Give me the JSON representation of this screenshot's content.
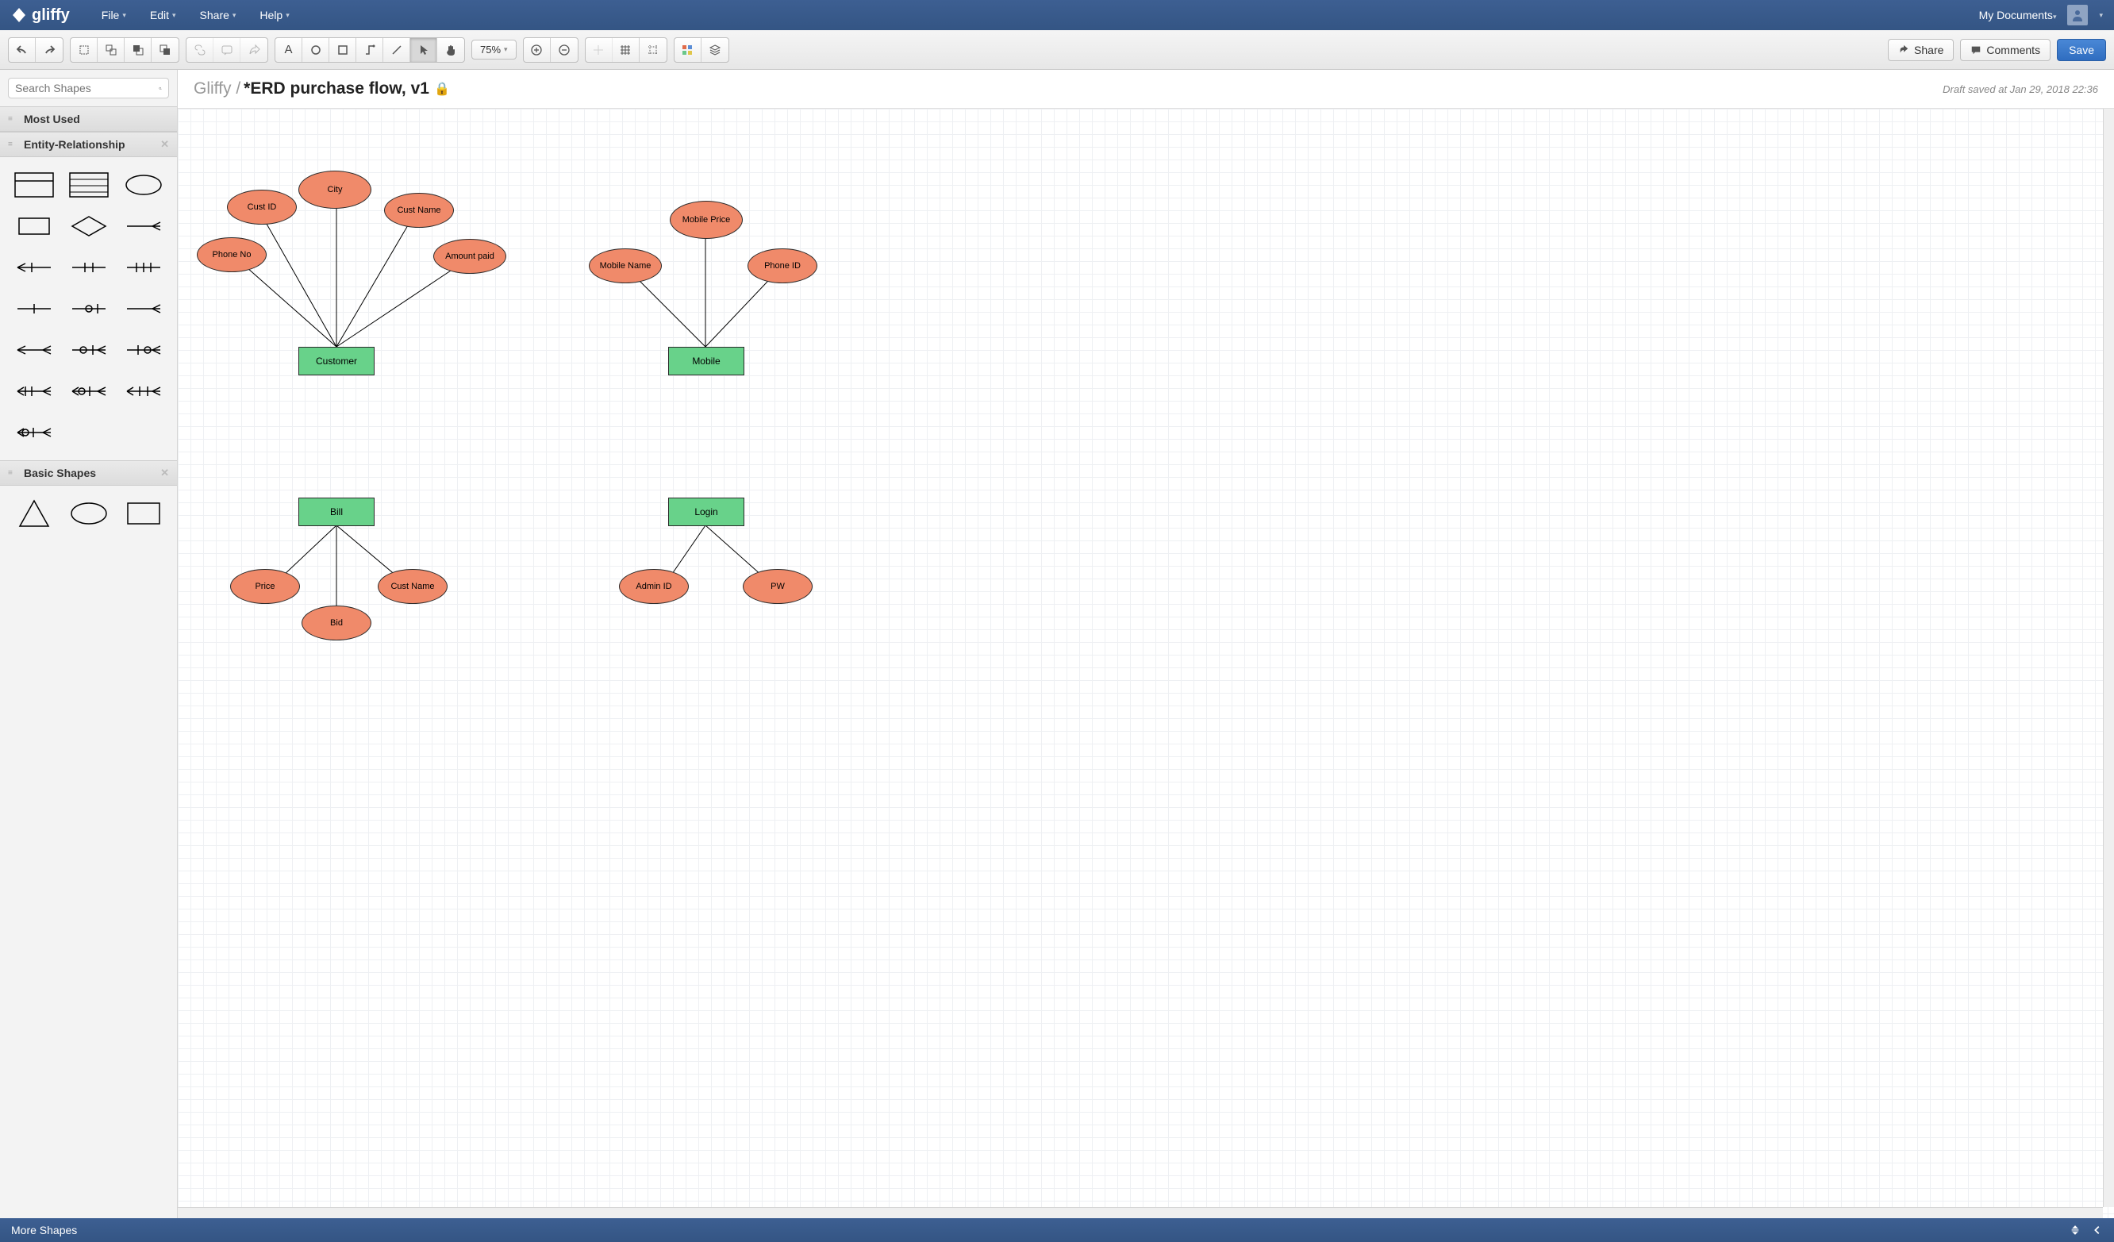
{
  "brand": "gliffy",
  "top_menus": [
    "File",
    "Edit",
    "Share",
    "Help"
  ],
  "my_documents": "My Documents",
  "toolbar": {
    "zoom": "75%",
    "share": "Share",
    "comments": "Comments",
    "save": "Save"
  },
  "sidebar": {
    "search_placeholder": "Search Shapes",
    "categories": {
      "most_used": "Most Used",
      "er": "Entity-Relationship",
      "basic": "Basic Shapes"
    },
    "more_shapes": "More Shapes"
  },
  "doc": {
    "breadcrumb": "Gliffy",
    "sep": "/",
    "title": "*ERD purchase flow, v1",
    "saved": "Draft saved at Jan 29, 2018 22:36"
  },
  "erd": {
    "customer": {
      "entity": "Customer",
      "attrs": [
        "Cust ID",
        "City",
        "Cust Name",
        "Phone No",
        "Amount paid"
      ]
    },
    "mobile": {
      "entity": "Mobile",
      "attrs": [
        "Mobile Name",
        "Mobile Price",
        "Phone ID"
      ]
    },
    "bill": {
      "entity": "Bill",
      "attrs": [
        "Price",
        "Bid",
        "Cust Name"
      ]
    },
    "login": {
      "entity": "Login",
      "attrs": [
        "Admin ID",
        "PW"
      ]
    }
  }
}
